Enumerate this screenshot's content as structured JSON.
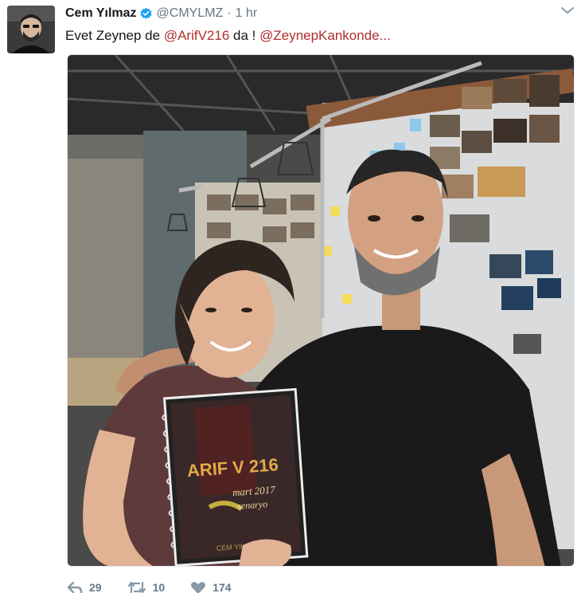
{
  "tweet": {
    "author_name": "Cem Yılmaz",
    "handle": "@CMYLMZ",
    "separator": "·",
    "time": "1 hr",
    "text_before": "Evet Zeynep de ",
    "mention_1": "@ArifV216",
    "text_middle": " da ! ",
    "mention_2": "@ZeynepKankonde...",
    "mention_color": "#b12d2d"
  },
  "media": {
    "notebook_title": "ARIF V 216",
    "notebook_subtitle_1": "mart 2017",
    "notebook_subtitle_2": "senaryo",
    "notebook_author": "CEM YILMAZ"
  },
  "actions": {
    "reply_count": "29",
    "retweet_count": "10",
    "like_count": "174"
  },
  "icons": {
    "verified": "verified-badge-icon",
    "menu": "chevron-down-icon",
    "reply": "reply-icon",
    "retweet": "retweet-icon",
    "like": "heart-icon"
  }
}
